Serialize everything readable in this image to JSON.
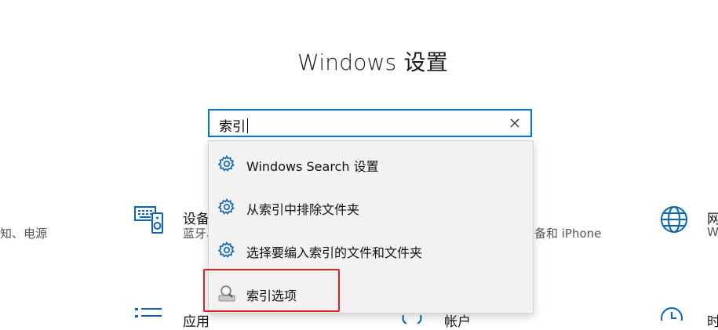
{
  "window": {
    "title": "Windows 设置"
  },
  "search": {
    "value": "索引",
    "clear_icon": "close-icon"
  },
  "results": [
    {
      "label": "Windows Search 设置",
      "icon": "gear-icon"
    },
    {
      "label": "从索引中排除文件夹",
      "icon": "gear-icon"
    },
    {
      "label": "选择要编入索引的文件和文件夹",
      "icon": "gear-icon"
    },
    {
      "label": "索引选项",
      "icon": "indexing-options-icon"
    }
  ],
  "background_tiles": {
    "left_partial_desc": "知、电源",
    "devices": {
      "title": "设备",
      "desc": "蓝牙、",
      "icon": "devices-icon"
    },
    "phone": {
      "desc": "备和 iPhone"
    },
    "network": {
      "title": "网",
      "desc": "W",
      "icon": "globe-icon"
    },
    "apps": {
      "title": "应用",
      "icon": "apps-icon"
    },
    "accounts": {
      "title": "帐户",
      "icon": "accounts-icon"
    },
    "time": {
      "title": "时",
      "icon": "clock-icon"
    }
  },
  "colors": {
    "accent": "#0078d7",
    "highlight": "#e02020"
  }
}
